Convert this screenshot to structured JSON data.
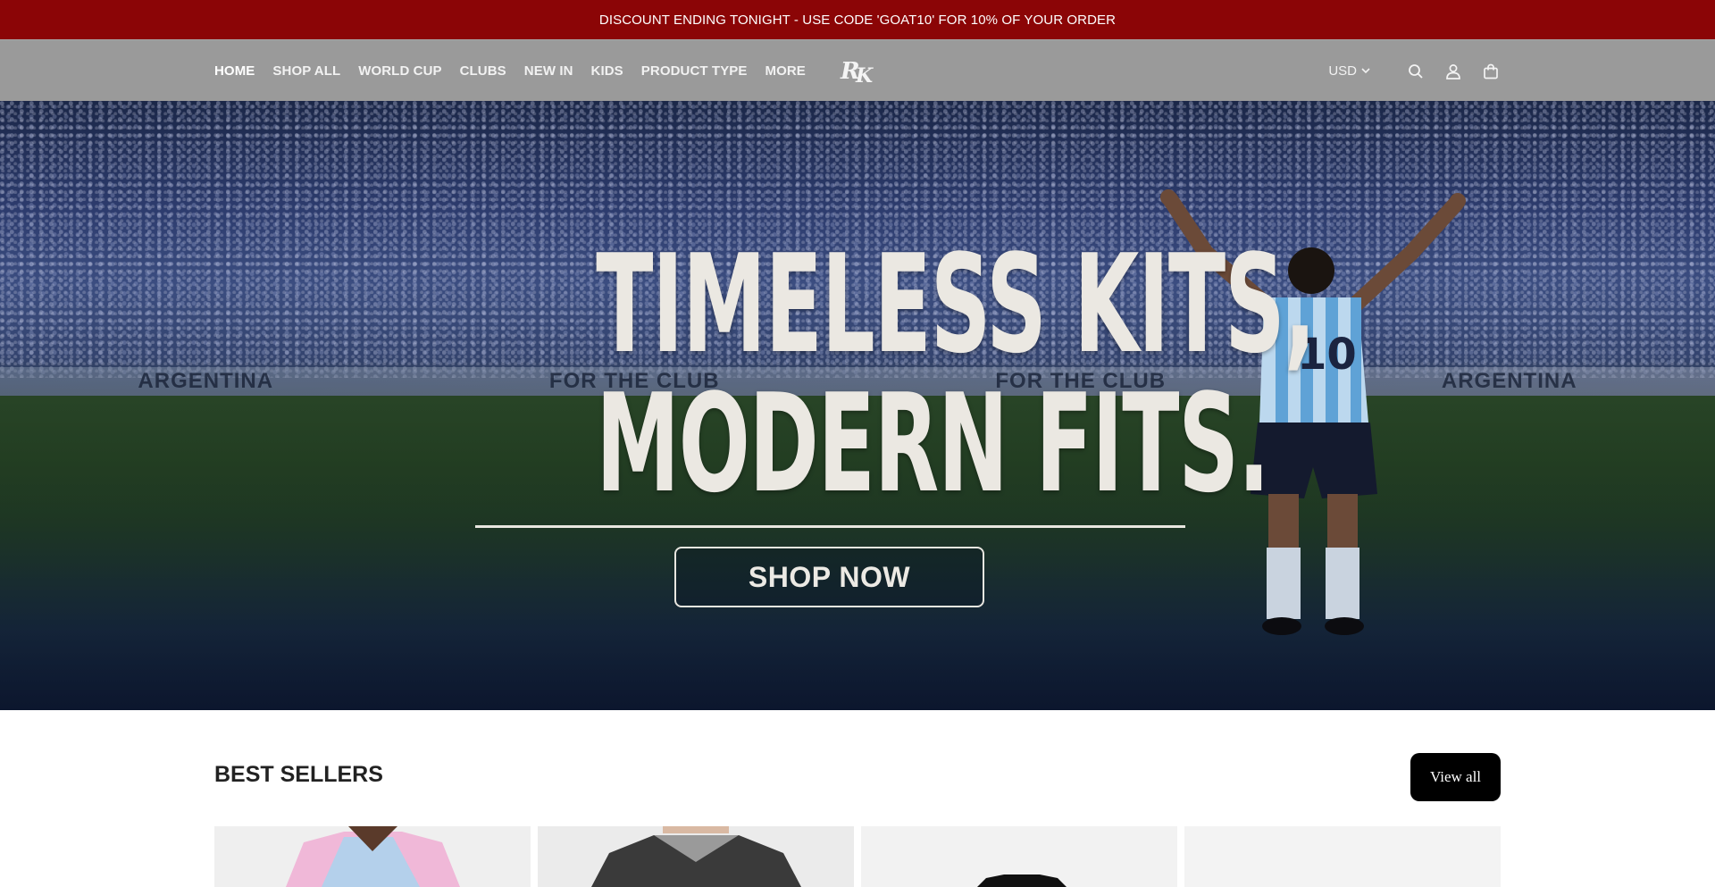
{
  "announcement": {
    "text": "DISCOUNT ENDING TONIGHT - USE CODE 'GOAT10' FOR 10% OF YOUR ORDER"
  },
  "header": {
    "nav": [
      {
        "label": "HOME",
        "active": true
      },
      {
        "label": "SHOP ALL"
      },
      {
        "label": "WORLD CUP"
      },
      {
        "label": "CLUBS"
      },
      {
        "label": "NEW IN"
      },
      {
        "label": "KIDS"
      },
      {
        "label": "PRODUCT TYPE"
      },
      {
        "label": "MORE"
      }
    ],
    "currency": "USD",
    "icons": [
      "search-icon",
      "account-icon",
      "cart-icon"
    ]
  },
  "hero": {
    "title_line1": "TIMELESS KITS,",
    "title_line2": "MODERN FITS.",
    "cta": "SHOP NOW",
    "banner_text": [
      "ARGENTINA",
      "FOR THE CLUB",
      "FOR THE CLUB",
      "ARGENTINA"
    ],
    "jersey_number": "10"
  },
  "best_sellers": {
    "title": "BEST SELLERS",
    "view_all": "View all",
    "products": [
      {
        "colors": [
          "#f0b8d8",
          "#a9d4ee"
        ]
      },
      {
        "colors": [
          "#3a3a3a",
          "#9a9a9a"
        ]
      },
      {
        "colors": [
          "#111111",
          "#f2f2f2"
        ]
      },
      {
        "colors": [
          "#f2f2f2",
          "#f2f2f2"
        ]
      }
    ]
  },
  "colors": {
    "announcement_bg": "#8b0506",
    "header_bg": "#9a9a9a",
    "button_bg": "#000000"
  }
}
